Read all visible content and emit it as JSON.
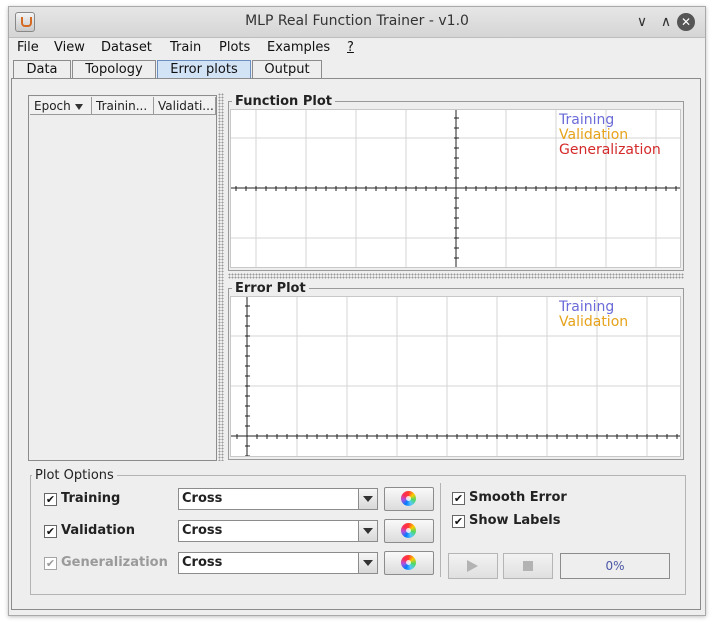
{
  "window": {
    "title": "MLP Real Function Trainer - v1.0",
    "controls": [
      "∨",
      "∧",
      "✕"
    ]
  },
  "menubar": [
    {
      "label": "File"
    },
    {
      "label": "View"
    },
    {
      "label": "Dataset"
    },
    {
      "label": "Train"
    },
    {
      "label": "Plots"
    },
    {
      "label": "Examples"
    },
    {
      "label": "?"
    }
  ],
  "tabs": [
    {
      "label": "Data",
      "active": false
    },
    {
      "label": "Topology",
      "active": false
    },
    {
      "label": "Error plots",
      "active": true
    },
    {
      "label": "Output",
      "active": false
    }
  ],
  "table": {
    "columns": [
      "Epoch",
      "Trainin...",
      "Validati..."
    ],
    "rows": []
  },
  "function_plot": {
    "title": "Function Plot",
    "legend": [
      {
        "name": "Training",
        "color": "#6b6bd9"
      },
      {
        "name": "Validation",
        "color": "#e6a21a"
      },
      {
        "name": "Generalization",
        "color": "#d42a2a"
      }
    ]
  },
  "error_plot": {
    "title": "Error Plot",
    "legend": [
      {
        "name": "Training",
        "color": "#6b6bd9"
      },
      {
        "name": "Validation",
        "color": "#e6a21a"
      }
    ]
  },
  "plot_options": {
    "title": "Plot Options",
    "series": [
      {
        "label": "Training",
        "checked": true,
        "enabled": true,
        "marker": "Cross"
      },
      {
        "label": "Validation",
        "checked": true,
        "enabled": true,
        "marker": "Cross"
      },
      {
        "label": "Generalization",
        "checked": true,
        "enabled": false,
        "marker": "Cross"
      }
    ],
    "smooth_error": {
      "label": "Smooth Error",
      "checked": true
    },
    "show_labels": {
      "label": "Show Labels",
      "checked": true
    },
    "progress": "0%",
    "check_mark": "✔"
  }
}
